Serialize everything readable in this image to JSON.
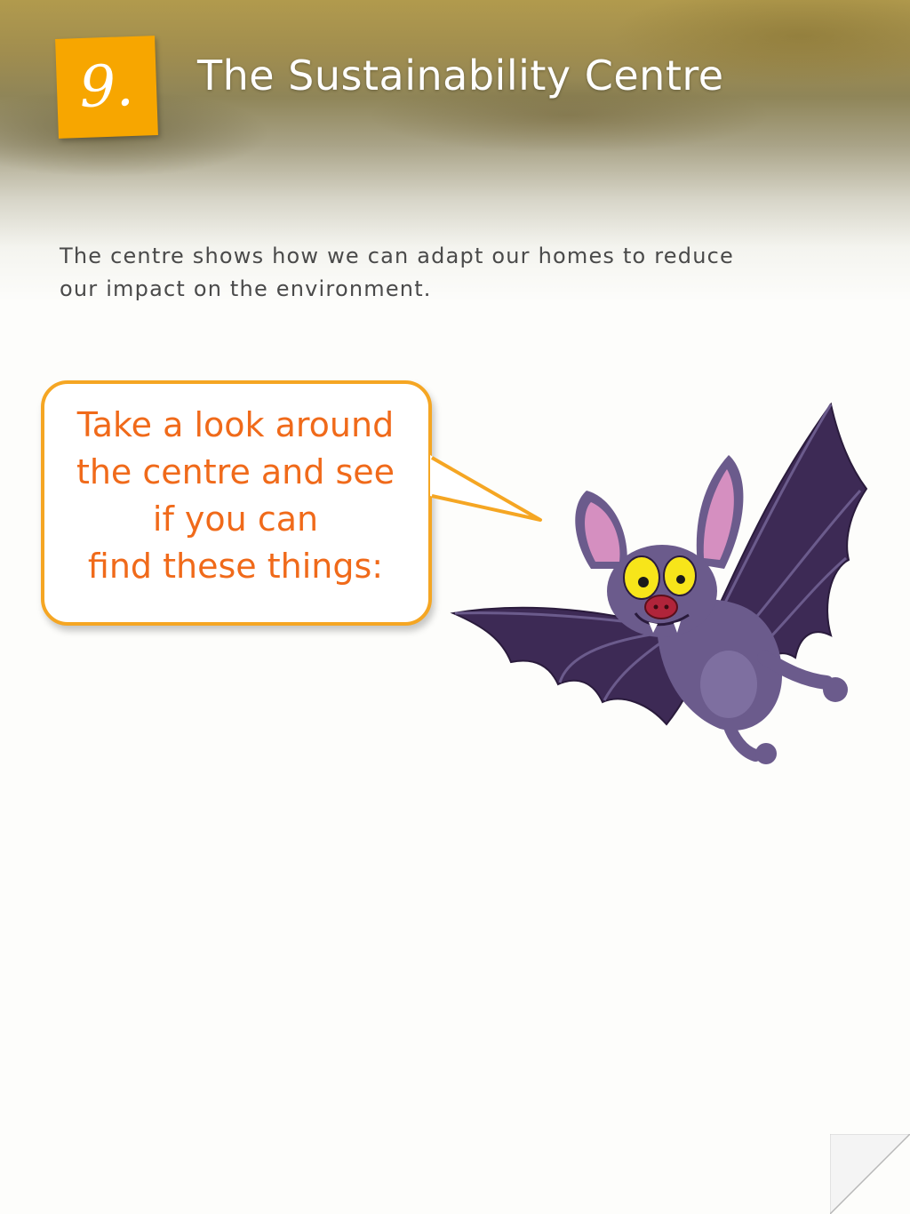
{
  "header": {
    "number": "9.",
    "title": "The Sustainability Centre"
  },
  "intro": {
    "text": "The centre shows how we can adapt our homes to reduce our impact on the environment."
  },
  "speech_bubble": {
    "lines": [
      "Take a look around",
      "the centre and see",
      "if you can",
      "find these things:"
    ]
  },
  "colors": {
    "badge": "#f7a600",
    "bubble_border": "#f5a623",
    "bubble_text": "#f06a1a",
    "bat_body": "#6b5b8c",
    "bat_wing": "#3d2a55"
  },
  "icons": {
    "mascot": "bat-mascot-icon",
    "page_turn": "page-curl-icon"
  }
}
